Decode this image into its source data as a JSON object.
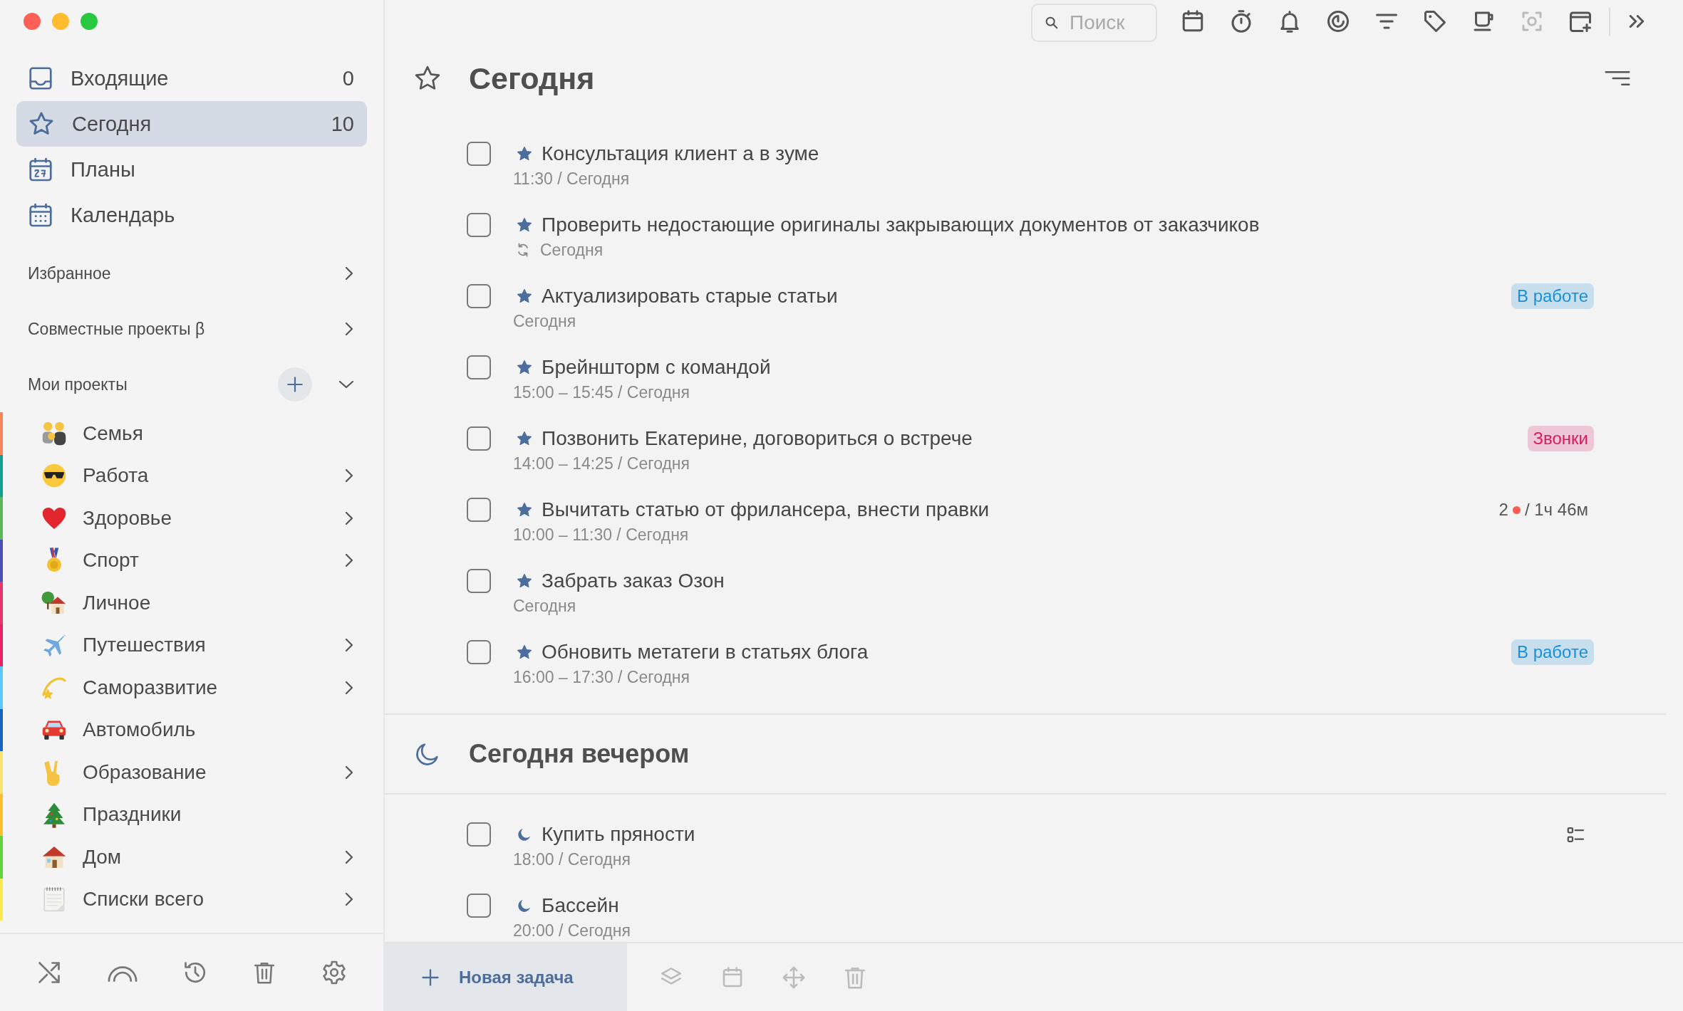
{
  "sidebar": {
    "nav": [
      {
        "kind": "inbox",
        "label": "Входящие",
        "count": "0",
        "selected": false
      },
      {
        "kind": "today",
        "label": "Сегодня",
        "count": "10",
        "selected": true
      },
      {
        "kind": "plans",
        "label": "Планы",
        "selected": false
      },
      {
        "kind": "calendar",
        "label": "Календарь",
        "selected": false
      }
    ],
    "sections": [
      {
        "label": "Избранное",
        "expanded": false
      },
      {
        "label": "Совместные проекты β",
        "expanded": false
      },
      {
        "label": "Мои проекты",
        "expanded": true,
        "add_button": true
      }
    ],
    "projects": [
      {
        "name": "Семья",
        "color": "#f5845a",
        "has_children": false
      },
      {
        "name": "Работа",
        "color": "#11a08f",
        "has_children": true
      },
      {
        "name": "Здоровье",
        "color": "#5cb85c",
        "has_children": true
      },
      {
        "name": "Спорт",
        "color": "#4b4fb8",
        "has_children": true
      },
      {
        "name": "Личное",
        "color": "#e8336b",
        "has_children": false
      },
      {
        "name": "Путешествия",
        "color": "#e91e63",
        "has_children": true
      },
      {
        "name": "Саморазвитие",
        "color": "#5ac8fa",
        "has_children": true
      },
      {
        "name": "Автомобиль",
        "color": "#1565c0",
        "has_children": false
      },
      {
        "name": "Образование",
        "color": "#f7e26b",
        "has_children": true
      },
      {
        "name": "Праздники",
        "color": "#fbc02d",
        "has_children": false
      },
      {
        "name": "Дом",
        "color": "#62d33a",
        "has_children": true
      },
      {
        "name": "Списки всего",
        "color": "#fce94f",
        "has_children": true
      }
    ]
  },
  "toolbar": {
    "search": {
      "placeholder": "Поиск"
    }
  },
  "sections": [
    {
      "kind": "today",
      "title": "Сегодня",
      "tasks": [
        {
          "title": "Консультация клиент а в зуме",
          "subtitle": "11:30 / Сегодня",
          "checked": false
        },
        {
          "title": "Проверить недостающие оригиналы закрывающих документов от заказчиков",
          "subtitle": "Сегодня",
          "repeat": true,
          "checked": false
        },
        {
          "title": "Актуализировать старые статьи",
          "subtitle": "Сегодня",
          "checked": false,
          "tag": {
            "label": "В работе",
            "color": "#1a8fd8"
          }
        },
        {
          "title": "Брейншторм с командой",
          "subtitle": "15:00 – 15:45 / Сегодня",
          "checked": false
        },
        {
          "title": "Позвонить Екатерине, договориться о встрече",
          "subtitle": "14:00 – 14:25 / Сегодня",
          "checked": false,
          "tag": {
            "label": "Звонки",
            "color": "#d81b60"
          }
        },
        {
          "title": "Вычитать статью от фрилансера, внести правки",
          "subtitle": "10:00 – 11:30 / Сегодня",
          "checked": false,
          "meta": {
            "count": "2",
            "color": "#ff5a4f",
            "time": "/ 1ч 46м"
          }
        },
        {
          "title": "Забрать заказ Озон",
          "subtitle": "Сегодня",
          "checked": false
        },
        {
          "title": "Обновить метатеги в статьях блога",
          "subtitle": "16:00 – 17:30 / Сегодня",
          "checked": false,
          "tag": {
            "label": "В работе",
            "color": "#1a8fd8"
          }
        }
      ]
    },
    {
      "kind": "evening",
      "title": "Сегодня вечером",
      "tasks": [
        {
          "title": "Купить пряности",
          "subtitle": "18:00 / Сегодня",
          "checked": false,
          "checklist": true
        },
        {
          "title": "Бассейн",
          "subtitle": "20:00 / Сегодня",
          "checked": false
        }
      ]
    }
  ],
  "bottom_bar": {
    "new_task": "Новая задача"
  }
}
